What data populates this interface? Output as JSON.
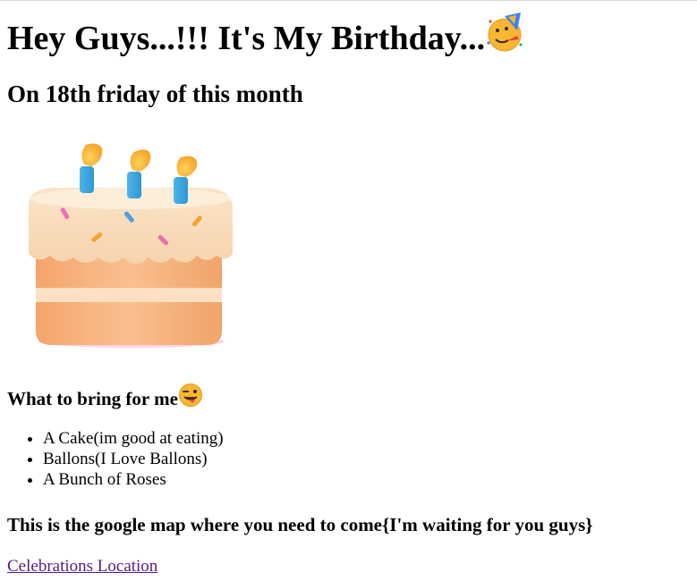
{
  "page": {
    "heading_main": "Hey Guys...!!! It's My Birthday...",
    "heading_date": "On 18th friday of this month",
    "bring_heading": "What to bring for me",
    "bring_items": [
      "A Cake(im good at eating)",
      "Ballons(I Love Ballons)",
      "A Bunch of Roses"
    ],
    "map_heading": "This is the google map where you need to come{I'm waiting for you guys}",
    "location_link": "Celebrations Location"
  },
  "icons": {
    "heading_emoji": "partying-face-icon",
    "bring_emoji": "winking-tongue-face-icon",
    "image": "birthday-cake-icon"
  },
  "colors": {
    "link_visited": "#551a8b",
    "text": "#000000",
    "background": "#ffffff"
  }
}
